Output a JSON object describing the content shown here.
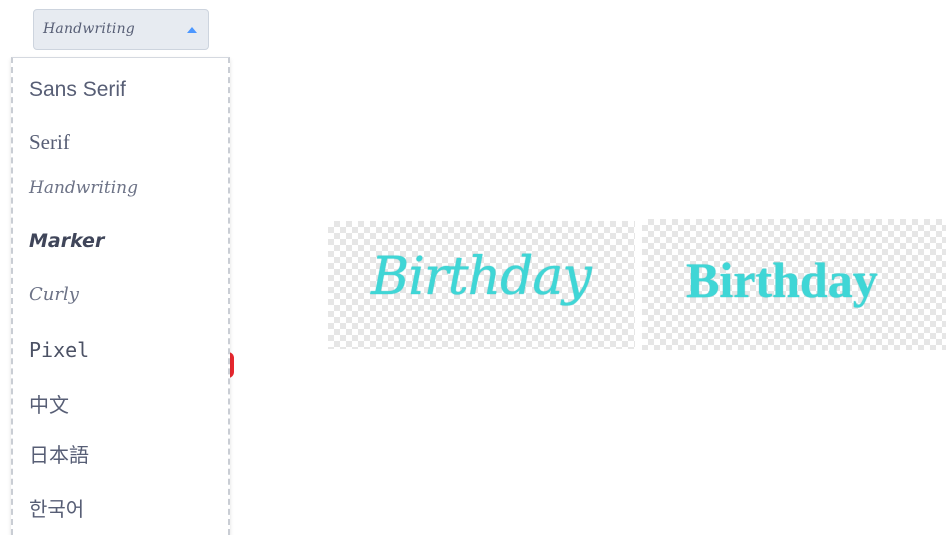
{
  "font_select": {
    "current_value": "Handwriting",
    "caret_icon": "caret-up-icon"
  },
  "menu": {
    "items": [
      {
        "label": "Sans Serif"
      },
      {
        "label": "Serif"
      },
      {
        "label": "Handwriting"
      },
      {
        "label": "Marker"
      },
      {
        "label": "Curly"
      },
      {
        "label": "Pixel"
      },
      {
        "label": "中文"
      },
      {
        "label": "日本語"
      },
      {
        "label": "한국어"
      }
    ]
  },
  "previews": [
    {
      "text": "Birthday",
      "color": "#3fd6d6"
    },
    {
      "text": "Birthday",
      "color": "#3fd6d6"
    }
  ],
  "colors": {
    "accent": "#4c97ff",
    "menu_text": "#575e75",
    "select_bg": "#e7ebf1",
    "preview_text": "#3fd6d6"
  }
}
